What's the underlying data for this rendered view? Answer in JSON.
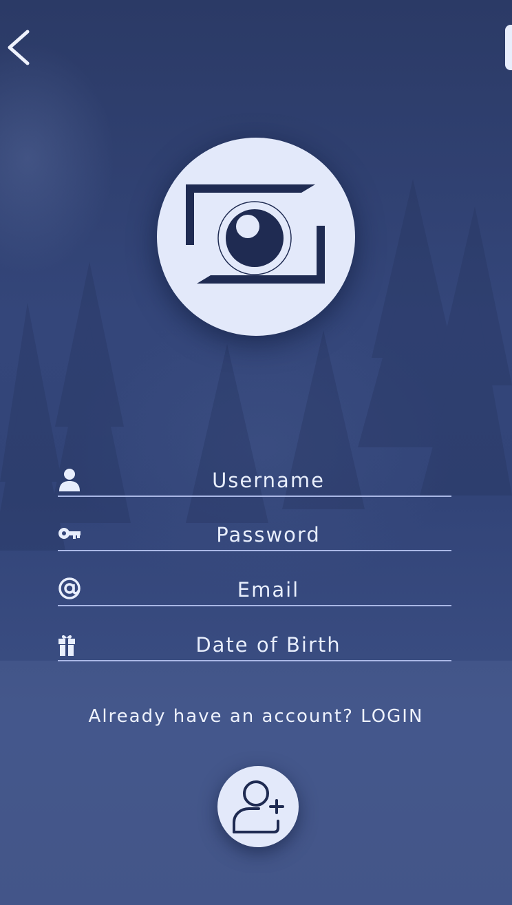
{
  "form": {
    "username_placeholder": "Username",
    "password_placeholder": "Password",
    "email_placeholder": "Email",
    "dob_placeholder": "Date of Birth"
  },
  "login_link": "Already have an account? LOGIN",
  "icons": {
    "back": "chevron-left-icon",
    "logo": "camera-icon",
    "username": "user-icon",
    "password": "key-icon",
    "email": "at-icon",
    "dob": "gift-icon",
    "signup": "add-user-icon"
  },
  "colors": {
    "background": "#2f3f6e",
    "accent_light": "#e3e9fa",
    "icon_dark": "#1f2b52",
    "underline": "#aab8e6",
    "text": "#e8eefc"
  }
}
